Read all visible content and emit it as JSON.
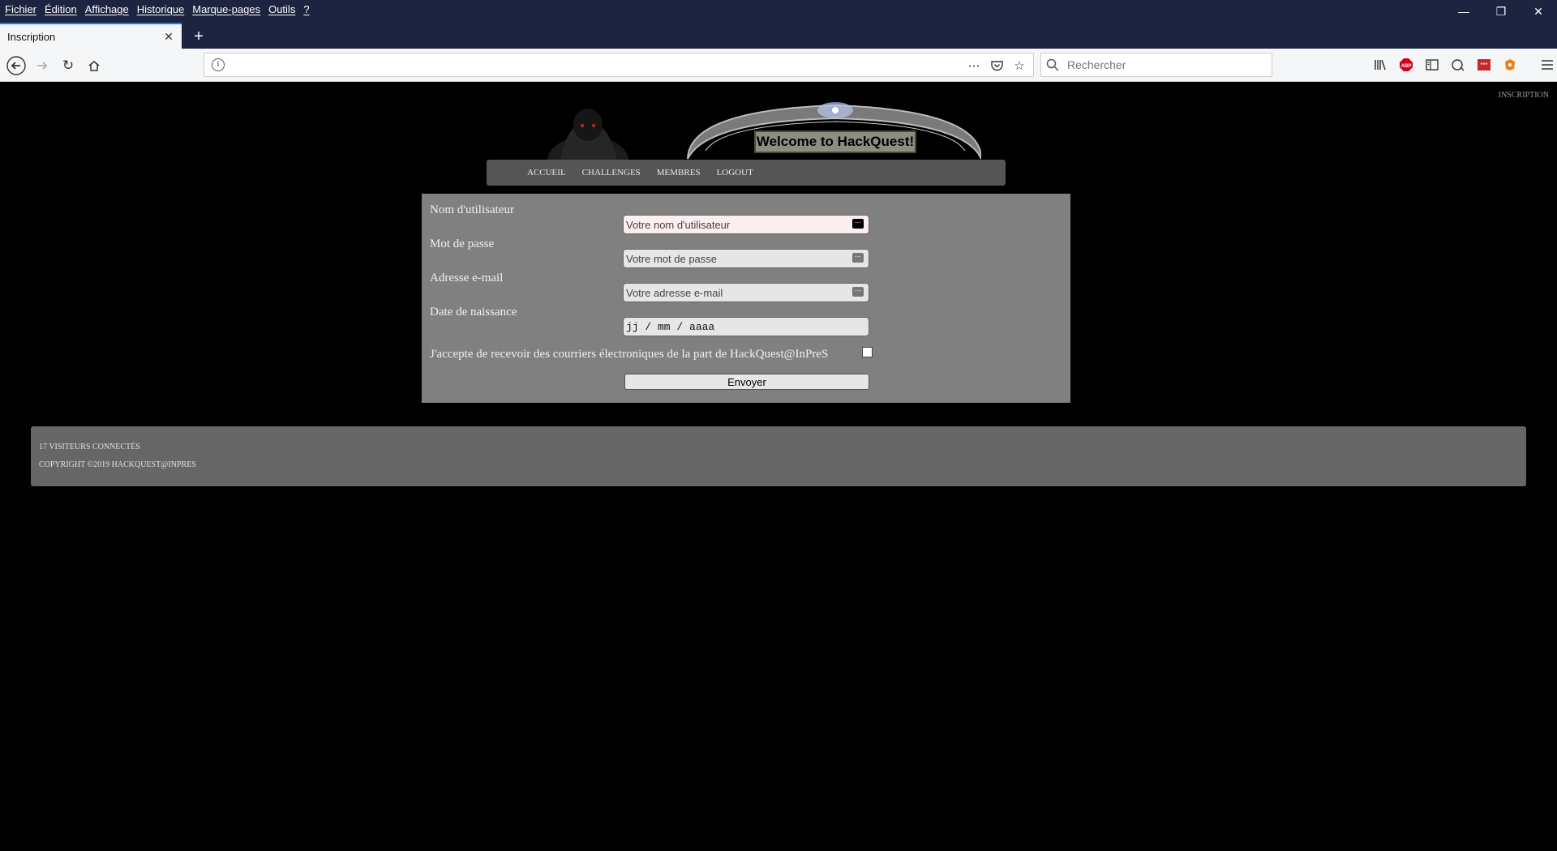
{
  "browser": {
    "menu": [
      "Fichier",
      "Édition",
      "Affichage",
      "Historique",
      "Marque-pages",
      "Outils",
      "?"
    ],
    "tab_title": "Inscription",
    "search_placeholder": "Rechercher"
  },
  "page": {
    "top_right_link": "INSCRIPTION",
    "banner_text": "Welcome to HackQuest!",
    "nav": [
      "ACCUEIL",
      "CHALLENGES",
      "MEMBRES",
      "LOGOUT"
    ]
  },
  "form": {
    "fields": [
      {
        "label": "Nom d'utilisateur",
        "placeholder": "Votre nom d'utilisateur"
      },
      {
        "label": "Mot de passe",
        "placeholder": "Votre mot de passe"
      },
      {
        "label": "Adresse e-mail",
        "placeholder": "Votre adresse e-mail"
      },
      {
        "label": "Date de naissance",
        "placeholder": "jj / mm / aaaa"
      }
    ],
    "consent": "J'accepte de recevoir des courriers électroniques de la part de HackQuest@InPreS",
    "submit": "Envoyer"
  },
  "footer": {
    "visitors": "17 VISITEURS CONNECTÉS",
    "copyright": "COPYRIGHT ©2019 HACKQUEST@INPRES"
  },
  "icons": [
    "back-icon",
    "forward-icon",
    "reload-icon",
    "home-icon",
    "info-icon",
    "more-icon",
    "pocket-icon",
    "bookmark-star-icon",
    "search-icon",
    "library-icon",
    "adblock-icon",
    "sidebar-icon",
    "screenshot-icon",
    "password-manager-icon",
    "extension-icon",
    "hamburger-menu-icon"
  ]
}
